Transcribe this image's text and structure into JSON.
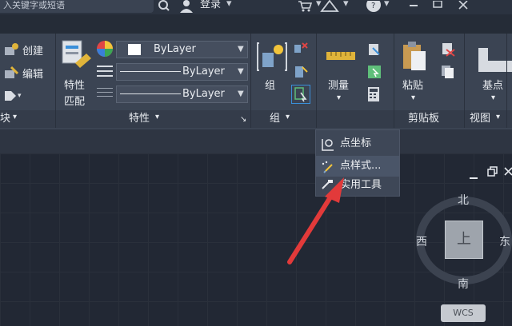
{
  "titlebar": {
    "search_text": "入关键字或短语",
    "login_label": "登录"
  },
  "ribbon": {
    "block_panel": {
      "create_label": "创建",
      "edit_label": "编辑",
      "panel_label": "块"
    },
    "properties_panel": {
      "match_label_1": "特性",
      "match_label_2": "匹配",
      "color_value": "ByLayer",
      "linetype_value": "ByLayer",
      "lineweight_value": "ByLayer",
      "panel_label": "特性"
    },
    "group_panel": {
      "group_label": "组",
      "panel_label": "组"
    },
    "utilities_panel": {
      "measure_label": "测量"
    },
    "clipboard_panel": {
      "paste_label": "粘贴",
      "panel_label": "剪贴板"
    },
    "view_panel": {
      "base_label": "基点",
      "panel_label": "视图"
    }
  },
  "menu": {
    "items": [
      {
        "label": "点坐标"
      },
      {
        "label": "点样式..."
      },
      {
        "label": "实用工具"
      }
    ]
  },
  "viewcube": {
    "north": "北",
    "south": "南",
    "west": "西",
    "east": "东",
    "face": "上",
    "wcs": "WCS"
  },
  "colors": {
    "accent_red": "#e23a3a",
    "ribbon_bg": "#3b4453",
    "canvas_bg": "#222834"
  }
}
